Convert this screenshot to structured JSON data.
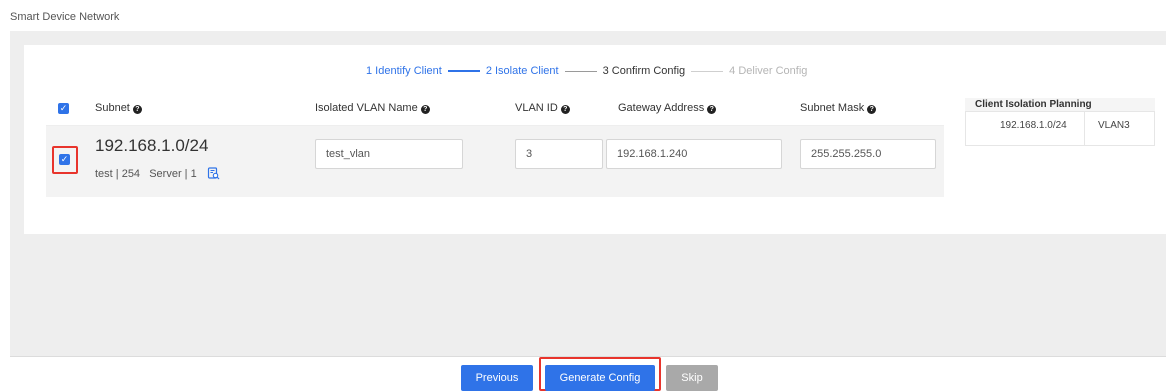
{
  "page": {
    "title": "Smart Device Network"
  },
  "stepper": {
    "steps": [
      {
        "label": "1 Identify Client",
        "state": "done"
      },
      {
        "label": "2 Isolate Client",
        "state": "current"
      },
      {
        "label": "3 Confirm Config",
        "state": "upcoming"
      },
      {
        "label": "4 Deliver Config",
        "state": "disabled"
      }
    ]
  },
  "table": {
    "headers": {
      "subnet": "Subnet",
      "vlan_name": "Isolated VLAN Name",
      "vlan_id": "VLAN ID",
      "gateway": "Gateway Address",
      "mask": "Subnet Mask"
    },
    "rows": [
      {
        "subnet": "192.168.1.0/24",
        "meta": "test | 254   Server | 1",
        "vlan_name": "test_vlan",
        "vlan_id": "3",
        "gateway": "192.168.1.240",
        "mask": "255.255.255.0",
        "checked": true
      }
    ]
  },
  "planning": {
    "title": "Client Isolation Planning",
    "rows": [
      {
        "subnet": "192.168.1.0/24",
        "vlan": "VLAN3"
      }
    ]
  },
  "footer": {
    "previous_label": "Previous",
    "generate_label": "Generate Config",
    "skip_label": "Skip"
  },
  "colors": {
    "accent": "#2f73e8",
    "highlight": "#e8342c",
    "skip_button": "#a9a9a9"
  },
  "icons": {
    "help": "question-circle-icon",
    "detail": "document-search-icon",
    "check": "checkmark-icon"
  }
}
